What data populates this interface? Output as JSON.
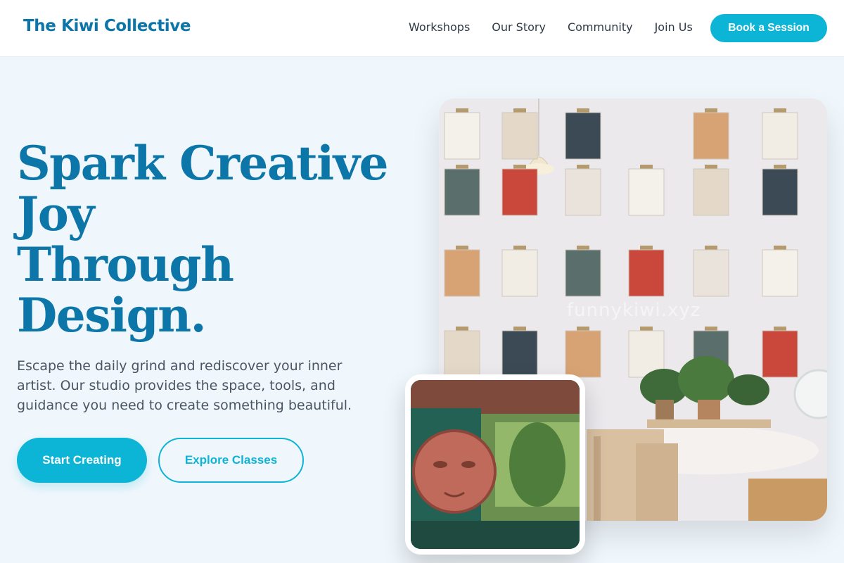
{
  "header": {
    "logo": "The Kiwi Collective",
    "nav": [
      "Workshops",
      "Our Story",
      "Community",
      "Join Us"
    ],
    "cta": "Book a Session"
  },
  "hero": {
    "headline_lines": [
      "Spark Creative",
      "Joy",
      "Through",
      "Design."
    ],
    "subtext": "Escape the daily grind and rediscover your inner artist. Our studio provides the space, tools, and guidance you need to create something beautiful.",
    "primary_button": "Start Creating",
    "secondary_button": "Explore Classes"
  },
  "images": {
    "main": "studio-wall-photo",
    "inset": "mural-face-photo",
    "watermark": "funnykiwi.xyz"
  },
  "colors": {
    "brand": "#0d76a8",
    "accent": "#0cb4d6",
    "background": "#f0f7fc"
  }
}
